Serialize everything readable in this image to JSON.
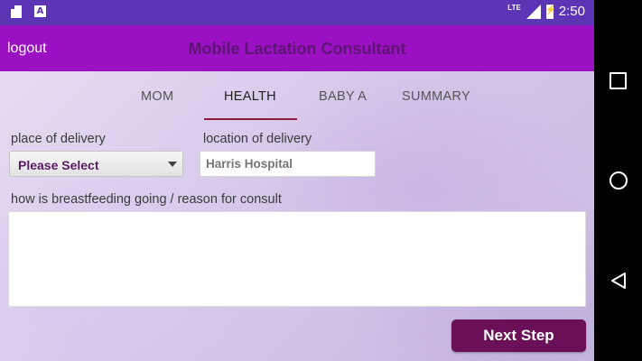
{
  "status_bar": {
    "left_icons": [
      "sd-card-icon",
      "a-notification-icon"
    ],
    "network_label": "LTE",
    "time": "2:50"
  },
  "app_bar": {
    "logout_label": "logout",
    "title": "Mobile Lactation Consultant",
    "background": "#9c10c4",
    "title_color": "#5c1570"
  },
  "tabs": [
    {
      "label": "MOM",
      "active": false
    },
    {
      "label": "HEALTH",
      "active": true
    },
    {
      "label": "BABY A",
      "active": false
    },
    {
      "label": "SUMMARY",
      "active": false
    }
  ],
  "form": {
    "place_label": "place of delivery",
    "place_value": "Please Select",
    "location_label": "location of delivery",
    "location_placeholder": "Harris Hospital",
    "consult_label": "how is breastfeeding going / reason for consult",
    "consult_value": ""
  },
  "next_button": {
    "label": "Next Step",
    "color": "#6b0f58"
  },
  "nav_bar": {
    "buttons": [
      "recents-square-icon",
      "home-circle-icon",
      "back-triangle-icon"
    ]
  }
}
